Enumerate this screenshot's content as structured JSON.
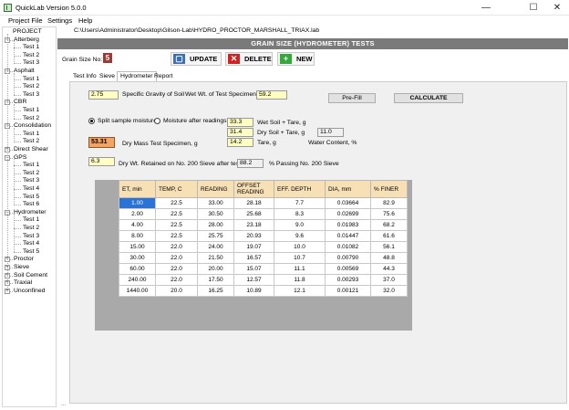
{
  "window": {
    "title": "QuickLab  Version 5.0.0",
    "minimize": "—",
    "maximize": "☐",
    "close": "✕"
  },
  "menu": [
    "Project File",
    "Settings",
    "Help"
  ],
  "tree": {
    "root": "PROJECT",
    "groups": [
      {
        "name": "Atterberg",
        "expanded": true,
        "children": [
          "Test 1",
          "Test 2",
          "Test 3"
        ]
      },
      {
        "name": "Asphalt",
        "expanded": true,
        "children": [
          "Test 1",
          "Test 2",
          "Test 3"
        ]
      },
      {
        "name": "CBR",
        "expanded": true,
        "children": [
          "Test 1",
          "Test 2"
        ]
      },
      {
        "name": "Consolidation",
        "expanded": true,
        "children": [
          "Test 1",
          "Test 2"
        ]
      },
      {
        "name": "Direct Shear",
        "expanded": false,
        "children": []
      },
      {
        "name": "GPS",
        "expanded": true,
        "children": [
          "Test 1",
          "Test 2",
          "Test 3",
          "Test 4",
          "Test 5",
          "Test 6"
        ]
      },
      {
        "name": "Hydrometer",
        "expanded": true,
        "children": [
          "Test 1",
          "Test 2",
          "Test 3",
          "Test 4",
          "Test 5"
        ]
      },
      {
        "name": "Proctor",
        "expanded": false,
        "children": []
      },
      {
        "name": "Sieve",
        "expanded": false,
        "children": []
      },
      {
        "name": "Soil Cement",
        "expanded": false,
        "children": []
      },
      {
        "name": "Traxial",
        "expanded": false,
        "children": []
      },
      {
        "name": "Unconfined",
        "expanded": false,
        "children": []
      }
    ]
  },
  "path": "C:\\Users\\Administrator\\Desktop\\Gilson-Lab\\HYDRO_PROCTOR_MARSHALL_TRIAX.lab",
  "header": "GRAIN SIZE (HYDROMETER) TESTS",
  "grain_size": {
    "label": "Grain Size No:",
    "value": "5"
  },
  "toolbar": {
    "update": "UPDATE",
    "delete": "DELETE",
    "new": "NEW"
  },
  "tabs": [
    "Test Info",
    "Sieve",
    "Hydrometer",
    "Report"
  ],
  "active_tab": "Hydrometer",
  "form": {
    "specific_gravity": {
      "value": "2.75",
      "label": "Specific Gravity of Soil"
    },
    "wet_wt": {
      "label": "Wet Wt. of Test Specimen:",
      "value": "59.2"
    },
    "prefill": "Pre-Fill",
    "calculate": "CALCULATE",
    "radio_split": "Split sample moisture",
    "radio_after": "Moisture after readings",
    "wet_soil_tare": {
      "value": "33.3",
      "label": "Wet Soil + Tare, g"
    },
    "dry_soil_tare": {
      "value": "31.4",
      "label": "Dry Soil + Tare, g"
    },
    "tare": {
      "value": "14.2",
      "label": "Tare, g"
    },
    "water_content": {
      "value": "11.0",
      "label": "Water Content, %"
    },
    "dry_mass": {
      "value": "53.31",
      "label": "Dry Mass Test Specimen, g"
    },
    "dry_wt_200": {
      "value": "6.3",
      "label": "Dry Wt. Retained on No. 200 Sieve after test"
    },
    "passing_200": {
      "value": "88.2",
      "label": "% Passing No. 200 Sieve"
    }
  },
  "table": {
    "columns": [
      "ET, min",
      "TEMP, C",
      "READING",
      "OFFSET READING",
      "EFF. DEPTH",
      "DIA, mm",
      "% FINER"
    ],
    "rows": [
      [
        "1.00",
        "22.5",
        "33.00",
        "28.18",
        "7.7",
        "0.03664",
        "82.9"
      ],
      [
        "2.00",
        "22.5",
        "30.50",
        "25.68",
        "8.3",
        "0.02699",
        "75.6"
      ],
      [
        "4.00",
        "22.5",
        "28.00",
        "23.18",
        "9.0",
        "0.01983",
        "68.2"
      ],
      [
        "8.00",
        "22.5",
        "25.75",
        "20.93",
        "9.6",
        "0.01447",
        "61.6"
      ],
      [
        "15.00",
        "22.0",
        "24.00",
        "19.07",
        "10.0",
        "0.01082",
        "56.1"
      ],
      [
        "30.00",
        "22.0",
        "21.50",
        "16.57",
        "10.7",
        "0.00790",
        "48.8"
      ],
      [
        "60.00",
        "22.0",
        "20.00",
        "15.07",
        "11.1",
        "0.00569",
        "44.3"
      ],
      [
        "240.00",
        "22.0",
        "17.50",
        "12.57",
        "11.8",
        "0.00293",
        "37.0"
      ],
      [
        "1440.00",
        "20.0",
        "16.25",
        "10.89",
        "12.1",
        "0.00121",
        "32.0"
      ]
    ]
  },
  "status": "..."
}
